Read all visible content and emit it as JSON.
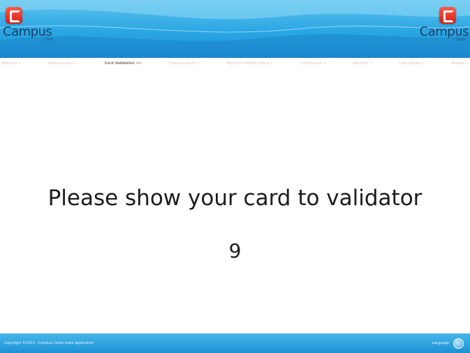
{
  "header": {
    "logo_left": {
      "text": "Campus",
      "sub": "Cards"
    },
    "logo_right": {
      "text": "Campus",
      "sub": "Cards"
    }
  },
  "steps": [
    {
      "label": "Welcome >",
      "active": false
    },
    {
      "label": "Authentication >",
      "active": false
    },
    {
      "label": "Card Validation >>",
      "active": true
    },
    {
      "label": "Choose product >",
      "active": false
    },
    {
      "label": "Payment method choice >",
      "active": false
    },
    {
      "label": "Confirmation >",
      "active": false
    },
    {
      "label": "Payment >",
      "active": false
    },
    {
      "label": "Card update >",
      "active": false
    },
    {
      "label": "Receipt >",
      "active": false
    }
  ],
  "main": {
    "message": "Please show your card to validator",
    "counter": "9"
  },
  "footer": {
    "copyright": "Copyright ©2013 - Campus Cards kiosk application",
    "language": "Language"
  },
  "colors": {
    "header_blue": "#2aa6e3",
    "footer_blue": "#1c90d4",
    "logo_red": "#d81e12"
  }
}
